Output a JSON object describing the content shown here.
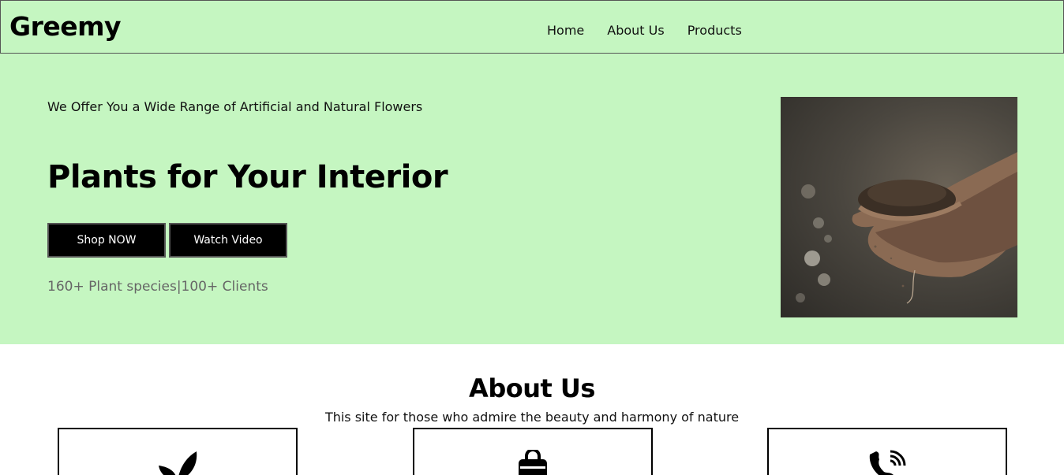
{
  "brand": "Greemy",
  "nav": {
    "items": [
      {
        "label": "Home"
      },
      {
        "label": "About Us"
      },
      {
        "label": "Products"
      }
    ]
  },
  "hero": {
    "tagline": "We Offer You a Wide Range of Artificial and Natural Flowers",
    "title": "Plants for Your Interior",
    "shop_button": "Shop NOW",
    "video_button": "Watch Video",
    "stats": "160+ Plant species|100+ Clients",
    "image": "hands-holding-soil-photo",
    "background": "#c5f6c1"
  },
  "about": {
    "title": "About Us",
    "subtitle": "This site for those who admire the beauty and harmony of nature",
    "cards": [
      {
        "icon": "leaf-icon"
      },
      {
        "icon": "shopping-bag-icon"
      },
      {
        "icon": "phone-call-icon"
      }
    ]
  }
}
